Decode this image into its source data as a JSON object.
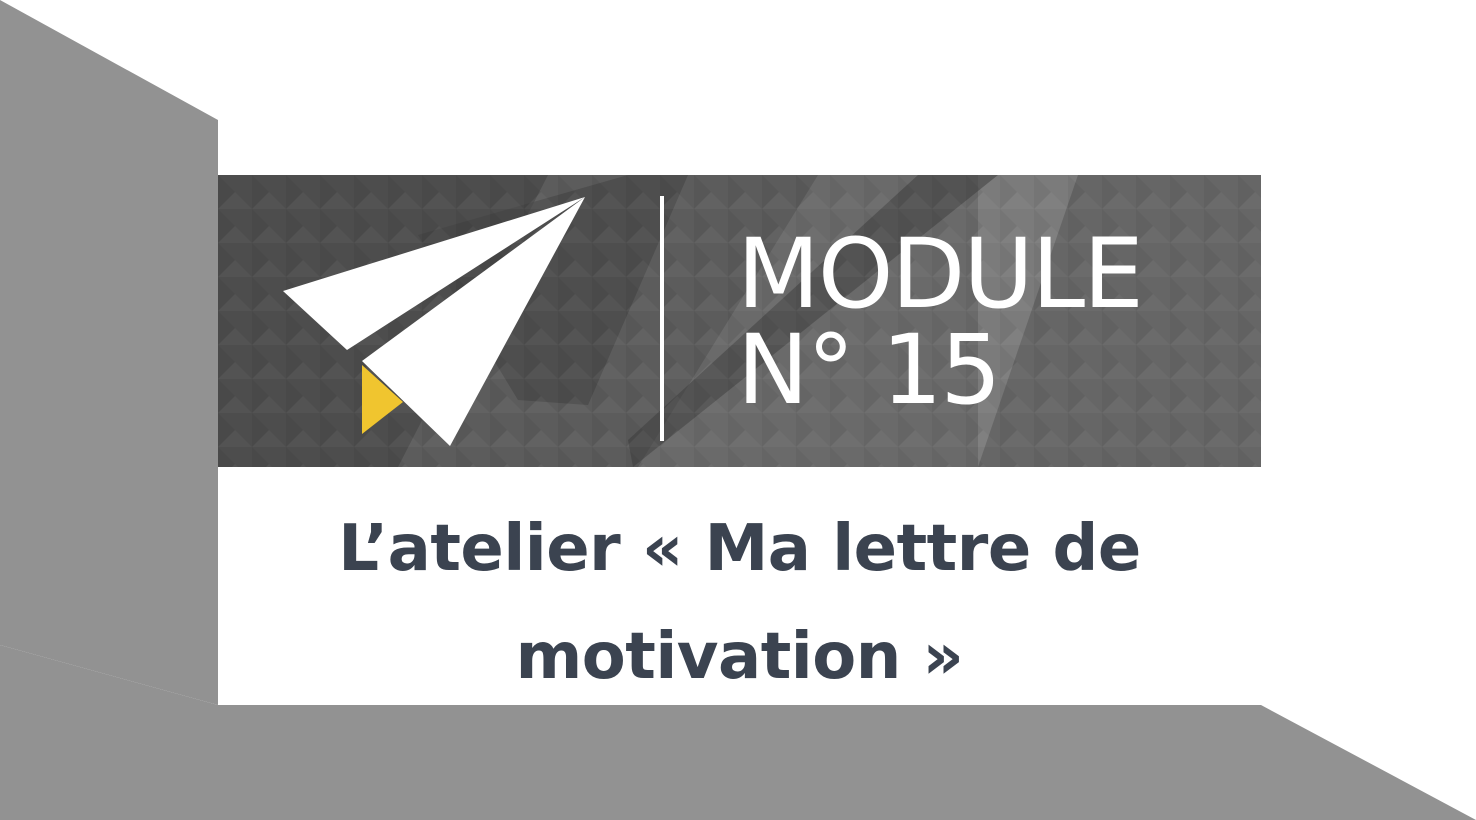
{
  "module": {
    "line1": "MODULE",
    "line2": "N° 15"
  },
  "title": "L’atelier « Ma lettre de motivation »",
  "icons": {
    "logo": "paper-plane-icon"
  },
  "colors": {
    "frame_gray": "#929292",
    "banner_dark": "#4d4d4d",
    "accent_yellow": "#f0c52f",
    "text_dark": "#3b4350",
    "white": "#ffffff"
  }
}
